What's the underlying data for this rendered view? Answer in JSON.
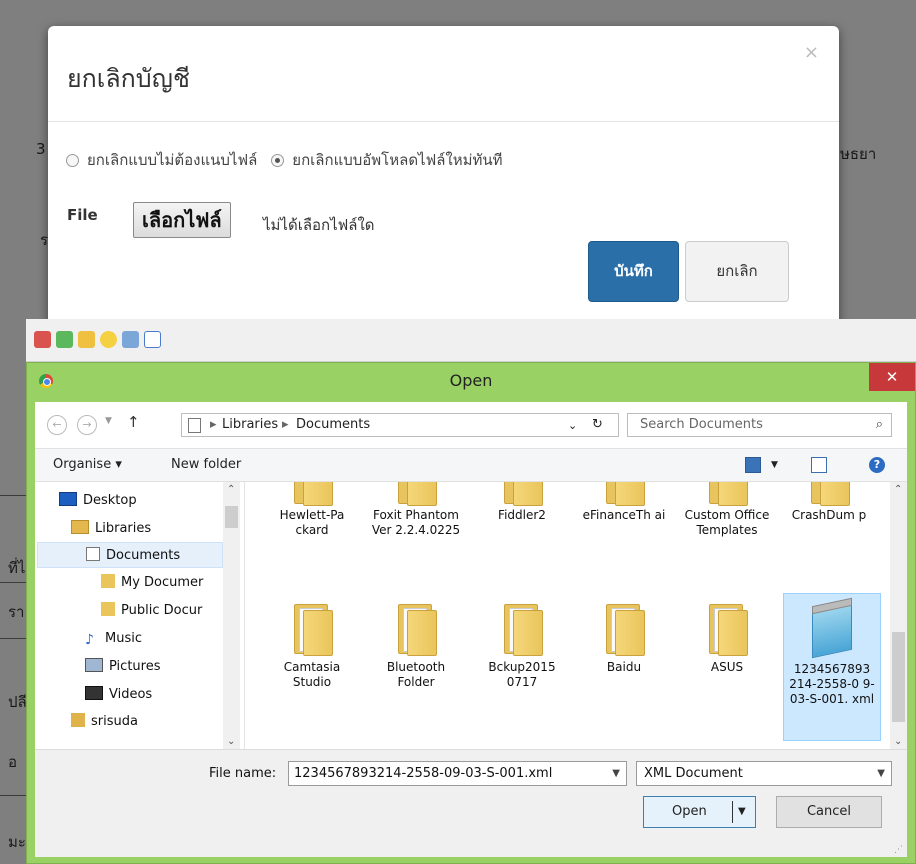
{
  "modal": {
    "title": "ยกเลิกบัญชี",
    "close": "×",
    "radio1_label": "ยกเลิกแบบไม่ต้องแนบไฟล์",
    "radio2_label": "ยกเลิกแบบอัพโหลดไฟล์ใหม่ทันที",
    "file_label": "File",
    "choose_file": "เลือกไฟล์",
    "no_file": "ไม่ได้เลือกไฟล์ใด",
    "save": "บันทึก",
    "cancel": "ยกเลิก"
  },
  "background": {
    "left_digit": "3",
    "left_fragment": "ร",
    "right_fragment": "ษธยา",
    "row_fragments": [
      "ที่ไ",
      "รา",
      "ปลี",
      "อ",
      "มะ"
    ]
  },
  "dialog": {
    "title": "Open",
    "close": "✕",
    "breadcrumb": [
      "Libraries",
      "Documents"
    ],
    "search_placeholder": "Search Documents",
    "organise": "Organise ▾",
    "new_folder": "New folder",
    "nav_items": [
      {
        "label": "Desktop",
        "icon": "desktop-icon"
      },
      {
        "label": "Libraries",
        "icon": "libraries-icon"
      },
      {
        "label": "Documents",
        "icon": "documents-icon",
        "selected": true
      },
      {
        "label": "My Documer",
        "icon": "folder-icon"
      },
      {
        "label": "Public Docur",
        "icon": "folder-icon"
      },
      {
        "label": "Music",
        "icon": "music-icon"
      },
      {
        "label": "Pictures",
        "icon": "pictures-icon"
      },
      {
        "label": "Videos",
        "icon": "videos-icon"
      },
      {
        "label": "srisuda",
        "icon": "user-icon"
      }
    ],
    "files_row1": [
      "Hewlett-Pa ckard",
      "Foxit Phantom Ver 2.2.4.0225",
      "Fiddler2",
      "eFinanceTh ai",
      "Custom Office Templates",
      "CrashDum p"
    ],
    "files_row2": [
      "Camtasia Studio",
      "Bluetooth Folder",
      "Bckup2015 0717",
      "Baidu",
      "ASUS",
      "1234567893 214-2558-0 9-03-S-001. xml"
    ],
    "filename_label": "File name:",
    "filename_value": "1234567893214-2558-09-03-S-001.xml",
    "filetype": "XML Document",
    "open": "Open",
    "cancel": "Cancel"
  }
}
